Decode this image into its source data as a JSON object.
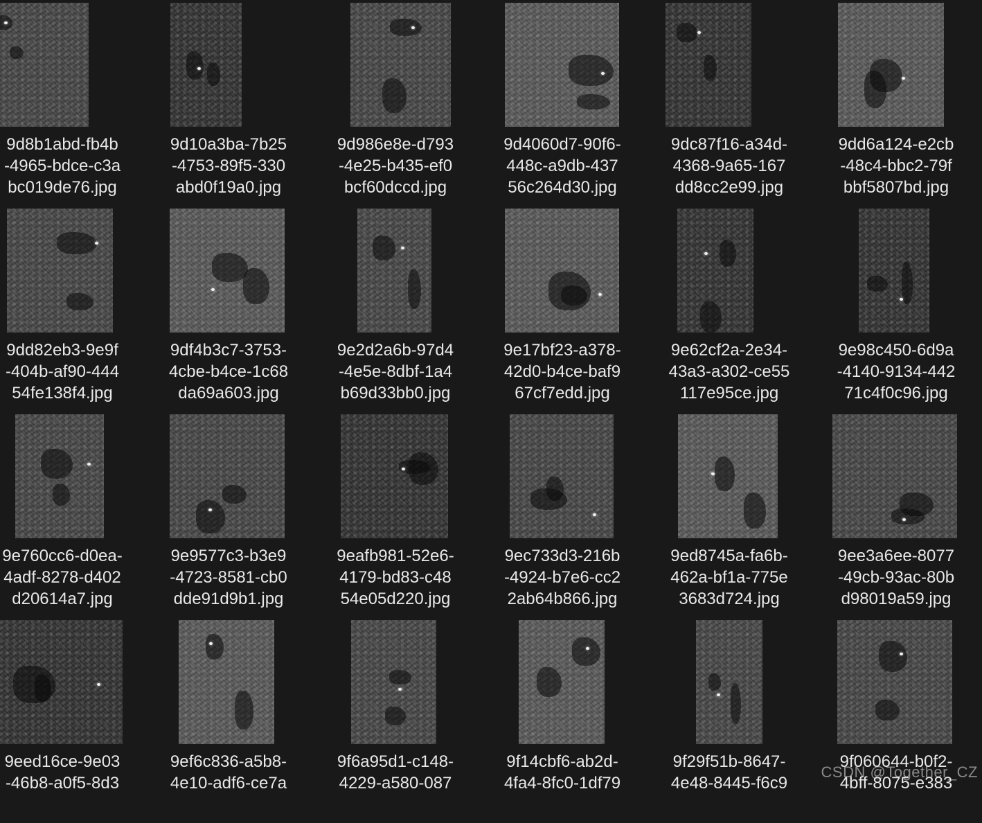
{
  "files": [
    {
      "line1": "9d8b1abd-fb4b",
      "line2": "-4965-bdce-c3a",
      "line3": "bc019de76.jpg"
    },
    {
      "line1": "9d10a3ba-7b25",
      "line2": "-4753-89f5-330",
      "line3": "abd0f19a0.jpg"
    },
    {
      "line1": "9d986e8e-d793",
      "line2": "-4e25-b435-ef0",
      "line3": "bcf60dccd.jpg"
    },
    {
      "line1": "9d4060d7-90f6-",
      "line2": "448c-a9db-437",
      "line3": "56c264d30.jpg"
    },
    {
      "line1": "9dc87f16-a34d-",
      "line2": "4368-9a65-167",
      "line3": "dd8cc2e99.jpg"
    },
    {
      "line1": "9dd6a124-e2cb",
      "line2": "-48c4-bbc2-79f",
      "line3": "bbf5807bd.jpg"
    },
    {
      "line1": "9dd82eb3-9e9f",
      "line2": "-404b-af90-444",
      "line3": "54fe138f4.jpg"
    },
    {
      "line1": "9df4b3c7-3753-",
      "line2": "4cbe-b4ce-1c68",
      "line3": "da69a603.jpg"
    },
    {
      "line1": "9e2d2a6b-97d4",
      "line2": "-4e5e-8dbf-1a4",
      "line3": "b69d33bb0.jpg"
    },
    {
      "line1": "9e17bf23-a378-",
      "line2": "42d0-b4ce-baf9",
      "line3": "67cf7edd.jpg"
    },
    {
      "line1": "9e62cf2a-2e34-",
      "line2": "43a3-a302-ce55",
      "line3": "117e95ce.jpg"
    },
    {
      "line1": "9e98c450-6d9a",
      "line2": "-4140-9134-442",
      "line3": "71c4f0c96.jpg"
    },
    {
      "line1": "9e760cc6-d0ea-",
      "line2": "4adf-8278-d402",
      "line3": "d20614a7.jpg"
    },
    {
      "line1": "9e9577c3-b3e9",
      "line2": "-4723-8581-cb0",
      "line3": "dde91d9b1.jpg"
    },
    {
      "line1": "9eafb981-52e6-",
      "line2": "4179-bd83-c48",
      "line3": "54e05d220.jpg"
    },
    {
      "line1": "9ec733d3-216b",
      "line2": "-4924-b7e6-cc2",
      "line3": "2ab64b866.jpg"
    },
    {
      "line1": "9ed8745a-fa6b-",
      "line2": "462a-bf1a-775e",
      "line3": "3683d724.jpg"
    },
    {
      "line1": "9ee3a6ee-8077",
      "line2": "-49cb-93ac-80b",
      "line3": "d98019a59.jpg"
    },
    {
      "line1": "9eed16ce-9e03",
      "line2": "-46b8-a0f5-8d3",
      "line3": ""
    },
    {
      "line1": "9ef6c836-a5b8-",
      "line2": "4e10-adf6-ce7a",
      "line3": ""
    },
    {
      "line1": "9f6a95d1-c148-",
      "line2": "4229-a580-087",
      "line3": ""
    },
    {
      "line1": "9f14cbf6-ab2d-",
      "line2": "4fa4-8fc0-1df79",
      "line3": ""
    },
    {
      "line1": "9f29f51b-8647-",
      "line2": "4e48-8445-f6c9",
      "line3": ""
    },
    {
      "line1": "9f060644-b0f2-",
      "line2": "4bff-8075-e383",
      "line3": ""
    }
  ],
  "watermark": "CSDN @Together_CZ"
}
